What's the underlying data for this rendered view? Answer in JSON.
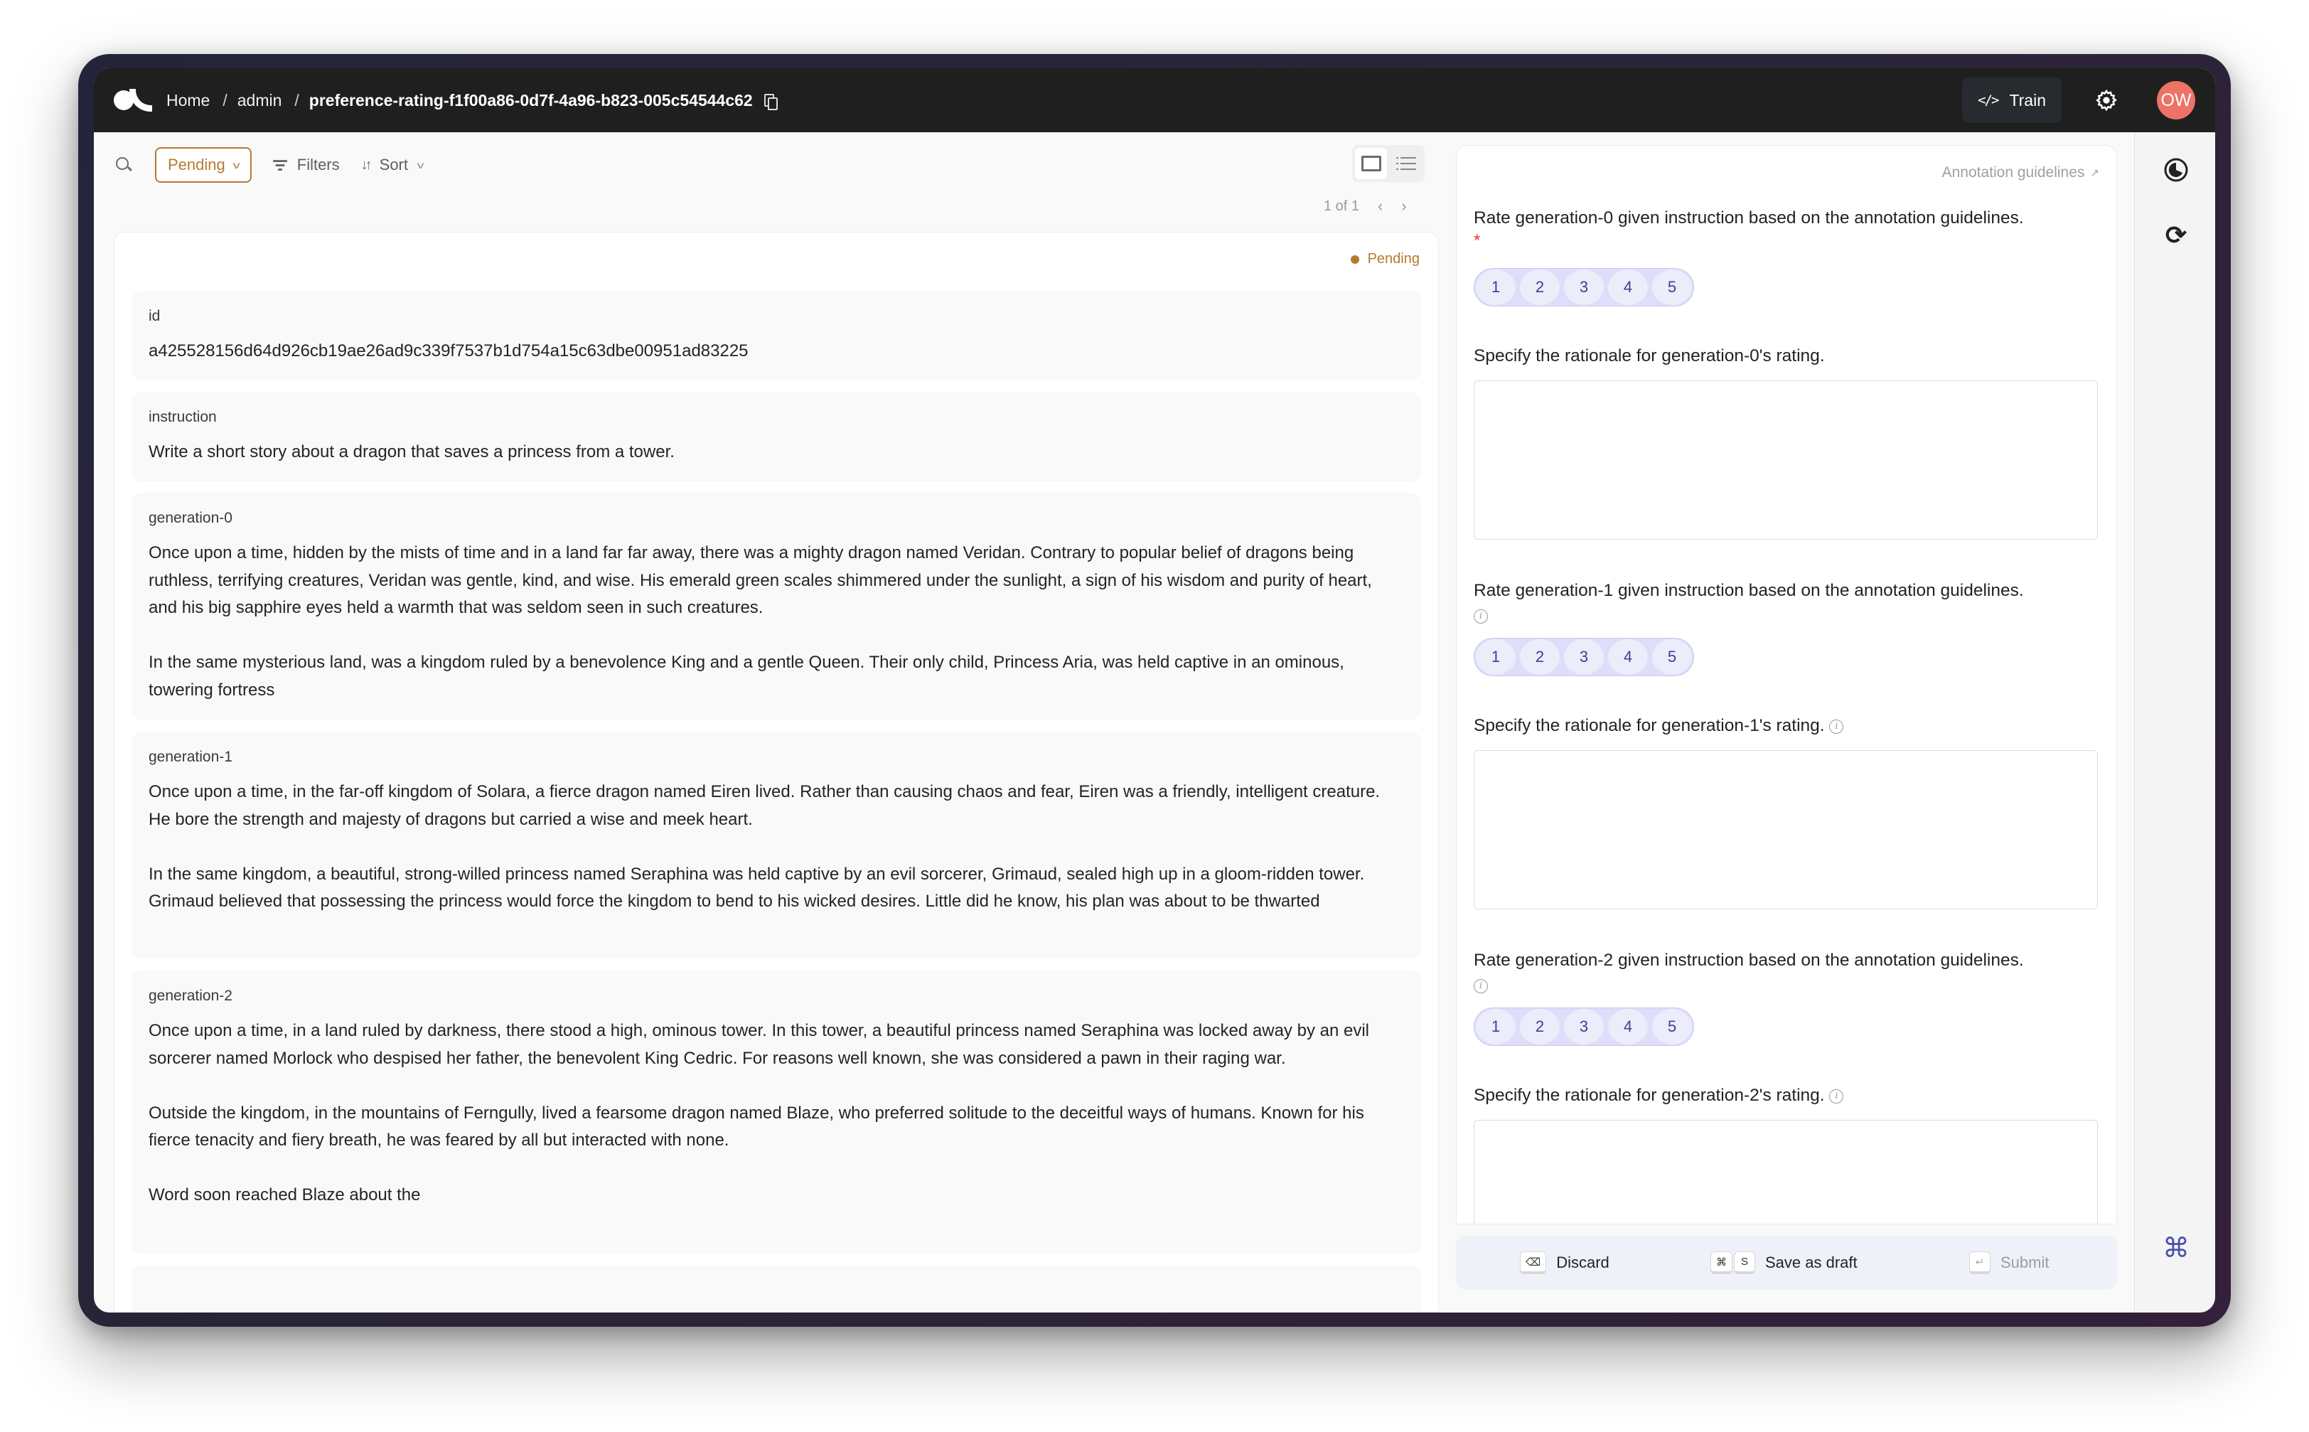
{
  "topbar": {
    "breadcrumb": {
      "home": "Home",
      "separator": "/",
      "workspace": "admin",
      "dataset": "preference-rating-f1f00a86-0d7f-4a96-b823-005c54544c62"
    },
    "train_label": "Train",
    "avatar_initials": "OW"
  },
  "toolbar": {
    "status_filter": "Pending",
    "filters_label": "Filters",
    "sort_label": "Sort"
  },
  "pagination": {
    "text": "1 of 1"
  },
  "record": {
    "status": "Pending",
    "fields": [
      {
        "label": "id",
        "value": "a425528156d64d926cb19ae26ad9c339f7537b1d754a15c63dbe00951ad83225"
      },
      {
        "label": "instruction",
        "value": "Write a short story about a dragon that saves a princess from a tower."
      },
      {
        "label": "generation-0",
        "value": "Once upon a time, hidden by the mists of time and in a land far far away, there was a mighty dragon named Veridan. Contrary to popular belief of dragons being ruthless, terrifying creatures, Veridan was gentle, kind, and wise. His emerald green scales shimmered under the sunlight, a sign of his wisdom and purity of heart, and his big sapphire eyes held a warmth that was seldom seen in such creatures.\n\nIn the same mysterious land, was a kingdom ruled by a benevolence King and a gentle Queen. Their only child, Princess Aria, was held captive in an ominous, towering fortress"
      },
      {
        "label": "generation-1",
        "value": "Once upon a time, in the far-off kingdom of Solara, a fierce dragon named Eiren lived. Rather than causing chaos and fear, Eiren was a friendly, intelligent creature. He bore the strength and majesty of dragons but carried a wise and meek heart.\n\nIn the same kingdom, a beautiful, strong-willed princess named Seraphina was held captive by an evil sorcerer, Grimaud, sealed high up in a gloom-ridden tower. Grimaud believed that possessing the princess would force the kingdom to bend to his wicked desires. Little did he know, his plan was about to be thwarted"
      },
      {
        "label": "generation-2",
        "value": "Once upon a time, in a land ruled by darkness, there stood a high, ominous tower. In this tower, a beautiful princess named Seraphina was locked away by an evil sorcerer named Morlock who despised her father, the benevolent King Cedric. For reasons well known, she was considered a pawn in their raging war.\n\nOutside the kingdom, in the mountains of Ferngully, lived a fearsome dragon named Blaze, who preferred solitude to the deceitful ways of humans. Known for his fierce tenacity and fiery breath, he was feared by all but interacted with none.\n\nWord soon reached Blaze about the"
      }
    ]
  },
  "form": {
    "guidelines_link": "Annotation guidelines",
    "questions": [
      {
        "rating_title": "Rate generation-0 given instruction based on the annotation guidelines.",
        "required": "*",
        "rationale_title": "Specify the rationale for generation-0's rating.",
        "options": [
          "1",
          "2",
          "3",
          "4",
          "5"
        ]
      },
      {
        "rating_title": "Rate generation-1 given instruction based on the annotation guidelines.",
        "rationale_title": "Specify the rationale for generation-1's rating.",
        "options": [
          "1",
          "2",
          "3",
          "4",
          "5"
        ]
      },
      {
        "rating_title": "Rate generation-2 given instruction based on the annotation guidelines.",
        "rationale_title": "Specify the rationale for generation-2's rating.",
        "options": [
          "1",
          "2",
          "3",
          "4",
          "5"
        ]
      }
    ],
    "actions": {
      "discard": {
        "label": "Discard",
        "key": "⌫"
      },
      "save_draft": {
        "label": "Save as draft",
        "keys": [
          "⌘",
          "S"
        ]
      },
      "submit": {
        "label": "Submit",
        "key": "↵"
      }
    }
  },
  "rail": {
    "command_glyph": "⌘",
    "refresh_glyph": "⟳"
  },
  "colors": {
    "pending": "#b57a32",
    "rating_bg": "#dedefa",
    "rating_text": "#3f3f8f",
    "avatar": "#ec7366",
    "command_icon": "#4a4fa8",
    "required": "#e53935"
  }
}
